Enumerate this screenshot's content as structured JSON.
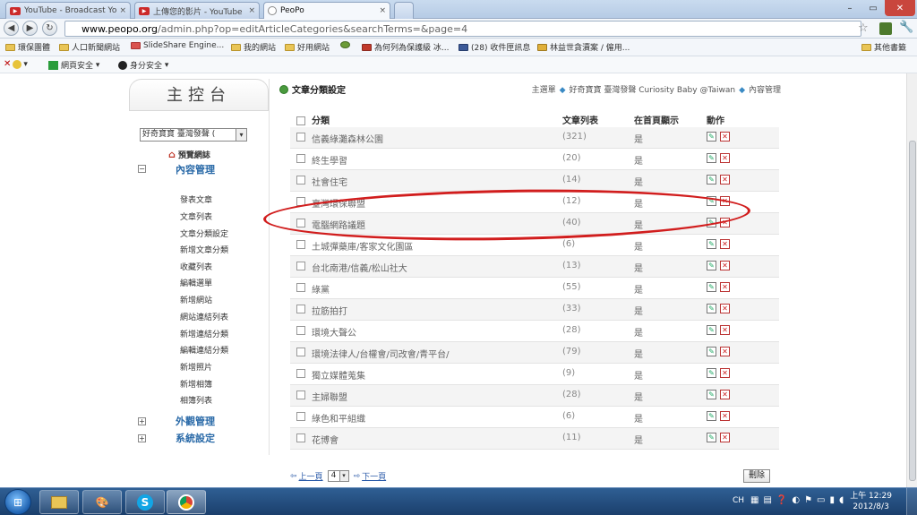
{
  "browser": {
    "tabs": [
      {
        "label": "YouTube - Broadcast Yo",
        "icon": "youtube-icon"
      },
      {
        "label": "上傳您的影片 - YouTube",
        "icon": "youtube-icon"
      },
      {
        "label": "PeoPo",
        "icon": "peopo-icon"
      }
    ],
    "url_domain": "www.peopo.org",
    "url_rest": "/admin.php?op=editArticleCategories&searchTerms=&page=4",
    "bookmarks": [
      "環保團體",
      "人口新聞網站",
      "SlideShare Engine...",
      "我的網站",
      "好用網站",
      "為何列為保護級 冰...",
      "(28) 收件匣訊息",
      "林益世貪瀆案 / 僱用...",
      "其他書籤"
    ],
    "toolbar2": [
      "網頁安全",
      "身分安全"
    ]
  },
  "sidebar": {
    "panel_title": "主控台",
    "site_select": "好奇寶寶 臺灣發聲 (",
    "preview_link": "預覽網誌",
    "sections": [
      {
        "label": "內容管理",
        "expanded": true
      },
      {
        "label": "外觀管理",
        "expanded": false
      },
      {
        "label": "系統設定",
        "expanded": false
      }
    ],
    "content_items": [
      "發表文章",
      "文章列表",
      "文章分類設定",
      "新增文章分類",
      "收藏列表",
      "編輯選單",
      "新增網站",
      "網站連結列表",
      "新增連結分類",
      "編輯連結分類",
      "新增照片",
      "新增相簿",
      "相簿列表"
    ]
  },
  "content": {
    "title": "文章分類設定",
    "breadcrumb": [
      "主選單",
      "好奇寶寶 臺灣發聲 Curiosity Baby @Taiwan",
      "內容管理"
    ],
    "headers": {
      "name": "分類",
      "count": "文章列表",
      "show": "在首頁顯示",
      "action": "動作"
    },
    "rows": [
      {
        "name": "信義綠灘森林公園",
        "count": "(321)",
        "show": "是"
      },
      {
        "name": "終生學習",
        "count": "(20)",
        "show": "是"
      },
      {
        "name": "社會住宅",
        "count": "(14)",
        "show": "是"
      },
      {
        "name": "臺灣環保聯盟",
        "count": "(12)",
        "show": "是"
      },
      {
        "name": "電腦網路議題",
        "count": "(40)",
        "show": "是"
      },
      {
        "name": "土城彈藥庫/客家文化園區",
        "count": "(6)",
        "show": "是"
      },
      {
        "name": "台北南港/信義/松山社大",
        "count": "(13)",
        "show": "是"
      },
      {
        "name": "綠黨",
        "count": "(55)",
        "show": "是"
      },
      {
        "name": "拉筋拍打",
        "count": "(33)",
        "show": "是"
      },
      {
        "name": "環境大聲公",
        "count": "(28)",
        "show": "是"
      },
      {
        "name": "環境法律人/台權會/司改會/青平台/",
        "count": "(79)",
        "show": "是"
      },
      {
        "name": "獨立媒體蒐集",
        "count": "(9)",
        "show": "是"
      },
      {
        "name": "主婦聯盟",
        "count": "(28)",
        "show": "是"
      },
      {
        "name": "綠色和平組織",
        "count": "(6)",
        "show": "是"
      },
      {
        "name": "花博會",
        "count": "(11)",
        "show": "是"
      }
    ],
    "pager": {
      "prev": "上一頁",
      "page": "4",
      "next": "下一頁"
    },
    "delete_label": "刪除"
  },
  "taskbar": {
    "lang": "CH",
    "time": "上午 12:29",
    "date": "2012/8/3"
  }
}
